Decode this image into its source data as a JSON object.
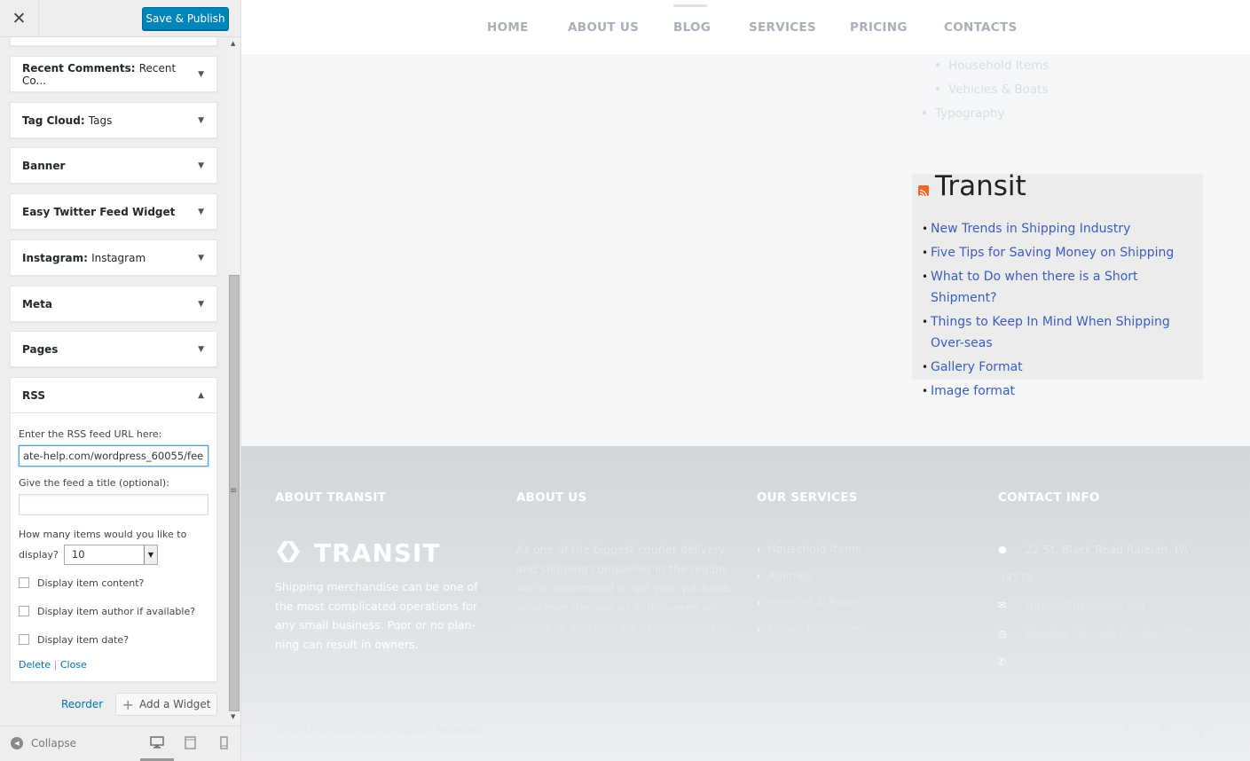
{
  "sidebar": {
    "publish_label": "Save & Publish",
    "widgets": [
      {
        "name": "Recent Comments",
        "subtitle": "Recent Co..."
      },
      {
        "name": "Tag Cloud",
        "subtitle": "Tags"
      },
      {
        "name": "Banner",
        "subtitle": ""
      },
      {
        "name": "Easy Twitter Feed Widget",
        "subtitle": ""
      },
      {
        "name": "Instagram",
        "subtitle": "Instagram"
      },
      {
        "name": "Meta",
        "subtitle": ""
      },
      {
        "name": "Pages",
        "subtitle": ""
      }
    ],
    "rss": {
      "name": "RSS",
      "url_label": "Enter the RSS feed URL here:",
      "url_value": "ate-help.com/wordpress_60055/feed",
      "title_label": "Give the feed a title (optional):",
      "title_value": "",
      "count_label_1": "How many items would you like to",
      "count_label_2": "display?",
      "count_value": "10",
      "check_content": "Display item content?",
      "check_author": "Display item author if available?",
      "check_date": "Display item date?",
      "delete_label": "Delete",
      "sep": " | ",
      "close_label": "Close"
    },
    "reorder_label": "Reorder",
    "add_widget_label": "Add a Widget",
    "collapse_label": "Collapse"
  },
  "preview": {
    "nav": [
      "HOME",
      "ABOUT US",
      "BLOG",
      "SERVICES",
      "PRICING",
      "CONTACTS"
    ],
    "faded_list": [
      "Household Items",
      "Vehicles & Boats",
      "Typography"
    ],
    "rss_widget": {
      "title": "Transit",
      "items": [
        "New Trends in Shipping Industry",
        "Five Tips for Saving Money on Shipping",
        "What to Do when there is a Short Shipment?",
        "Things to Keep In Mind When Shipping Over-seas",
        "Gallery Format",
        "Image format"
      ]
    },
    "footer": {
      "about_transit": {
        "heading": "ABOUT TRANSIT",
        "logo_text": "TRANSIT",
        "text_1": "Shipping merchandise can be one of",
        "text_2": "the most complicated operations for",
        "text_3": "any small business. Poor or no plan-",
        "text_4": "ning can result in owners."
      },
      "about_us": {
        "heading": "ABOUT US",
        "text_1": "As one of the biggest courier delivery",
        "text_2": "and shipping companies in the region,",
        "text_3": "we're determined to get your package,",
        "text_4": "whatever the size of it, delivered on",
        "text_5": "schedule and with no hassle involved!"
      },
      "services": {
        "heading": "OUR SERVICES",
        "items": [
          "Household Items",
          "Animals",
          "Vehicles & Boats",
          "Heavy Equipment"
        ]
      },
      "contact": {
        "heading": "CONTACT INFO",
        "address_1": "22 St. Black Road Raleigh, PA",
        "address_2": "34578",
        "email": "transit@demolink.org",
        "hours": "Monday through Sunday, 24/7",
        "phone": "Call us now:(617) 242-8181"
      },
      "copyright": "© 2016 Transit Inc. All Rights Reserved"
    }
  },
  "colors": {
    "accent": "#0085ba",
    "link": "#3a5cc0",
    "rss": "#f26522"
  }
}
